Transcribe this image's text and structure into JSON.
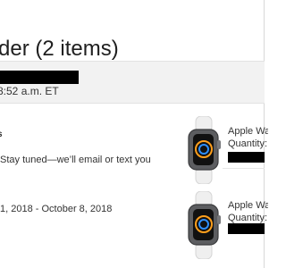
{
  "order": {
    "title": "der (2 items)",
    "placed_text": "8:52 a.m. ET"
  },
  "shipment": {
    "status_heading": "s",
    "status_message": "Stay tuned—we’ll email or text you",
    "delivery_range": "1, 2018 - October 8, 2018"
  },
  "items": [
    {
      "name": "Apple Wa",
      "quantity_label": "Quantity:"
    },
    {
      "name": "Apple Wa",
      "quantity_label": "Quantity:"
    }
  ],
  "colors": {
    "band": "#f2f2f2",
    "redaction": "#000000",
    "watch_case": "#5c5d60",
    "watch_band": "#eeeeee"
  }
}
